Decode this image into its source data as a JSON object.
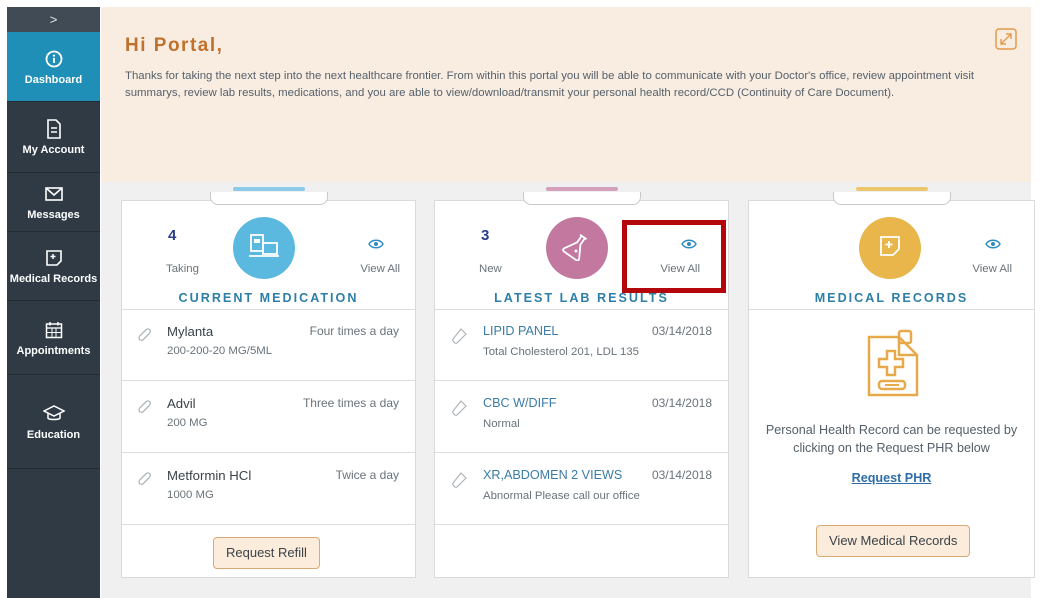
{
  "sidebar": {
    "toggle_label": ">",
    "items": [
      {
        "label": "Dashboard",
        "icon": "info-icon",
        "active": true
      },
      {
        "label": "My Account",
        "icon": "document-icon"
      },
      {
        "label": "Messages",
        "icon": "envelope-icon"
      },
      {
        "label": "Medical Records",
        "icon": "medical-file-icon"
      },
      {
        "label": "Appointments",
        "icon": "calendar-icon"
      },
      {
        "label": "Education",
        "icon": "graduation-cap-icon"
      }
    ]
  },
  "welcome": {
    "title": "Hi Portal,",
    "text": "Thanks for taking the next step into the next healthcare frontier.  From within this portal you will be able to communicate with your Doctor's office, review appointment visit summarys, review lab results, medications, and you are able to view/download/transmit your personal health record/CCD (Continuity of Care Document)."
  },
  "medication": {
    "count": "4",
    "count_label": "Taking",
    "view_all": "View All",
    "title": "CURRENT MEDICATION",
    "items": [
      {
        "name": "Mylanta",
        "dose": "200-200-20 MG/5ML",
        "frequency": "Four times a day"
      },
      {
        "name": "Advil",
        "dose": "200 MG",
        "frequency": "Three times a day"
      },
      {
        "name": "Metformin HCl",
        "dose": "1000 MG",
        "frequency": "Twice a day"
      }
    ],
    "button": "Request Refill"
  },
  "labs": {
    "count": "3",
    "count_label": "New",
    "view_all": "View All",
    "title": "LATEST LAB RESULTS",
    "items": [
      {
        "name": "LIPID PANEL",
        "date": "03/14/2018",
        "result": "Total Cholesterol 201, LDL 135"
      },
      {
        "name": "CBC W/DIFF",
        "date": "03/14/2018",
        "result": "Normal"
      },
      {
        "name": "XR,ABDOMEN 2 VIEWS",
        "date": "03/14/2018",
        "result": "Abnormal Please call our office"
      }
    ]
  },
  "records": {
    "view_all": "View All",
    "title": "MEDICAL RECORDS",
    "text_line1": "Personal Health Record can be requested by",
    "text_line2": "clicking on the Request PHR below",
    "link": "Request PHR",
    "button": "View Medical Records"
  },
  "colors": {
    "sidebar": "#2f3a44",
    "active": "#1f8fb7",
    "medication_accent": "#5bb8de",
    "labs_accent": "#c2789f",
    "records_accent": "#e8b64a",
    "highlight": "#b3070c"
  }
}
